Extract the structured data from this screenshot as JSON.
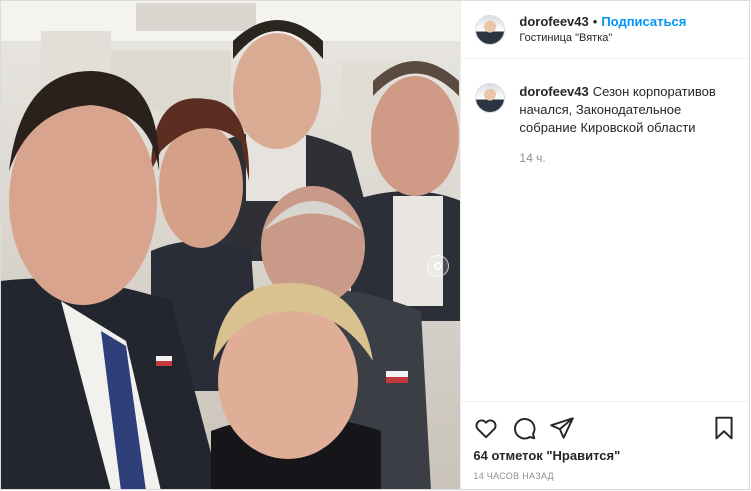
{
  "header": {
    "username": "dorofeev43",
    "separator": "•",
    "follow_label": "Подписаться",
    "location": "Гостиница \"Вятка\""
  },
  "caption": {
    "username": "dorofeev43",
    "text": "Сезон корпоративов начался, Законодательное собрание Кировской области",
    "time": "14 ч."
  },
  "actions": {
    "icons": [
      "heart-icon",
      "comment-icon",
      "share-icon",
      "bookmark-icon"
    ]
  },
  "likes_label": "64 отметок \"Нравится\"",
  "post_date": "14 ЧАСОВ НАЗАД",
  "colors": {
    "follow_blue": "#0095f6",
    "text": "#262626",
    "secondary": "#8e8e8e",
    "border": "#dbdbdb"
  }
}
